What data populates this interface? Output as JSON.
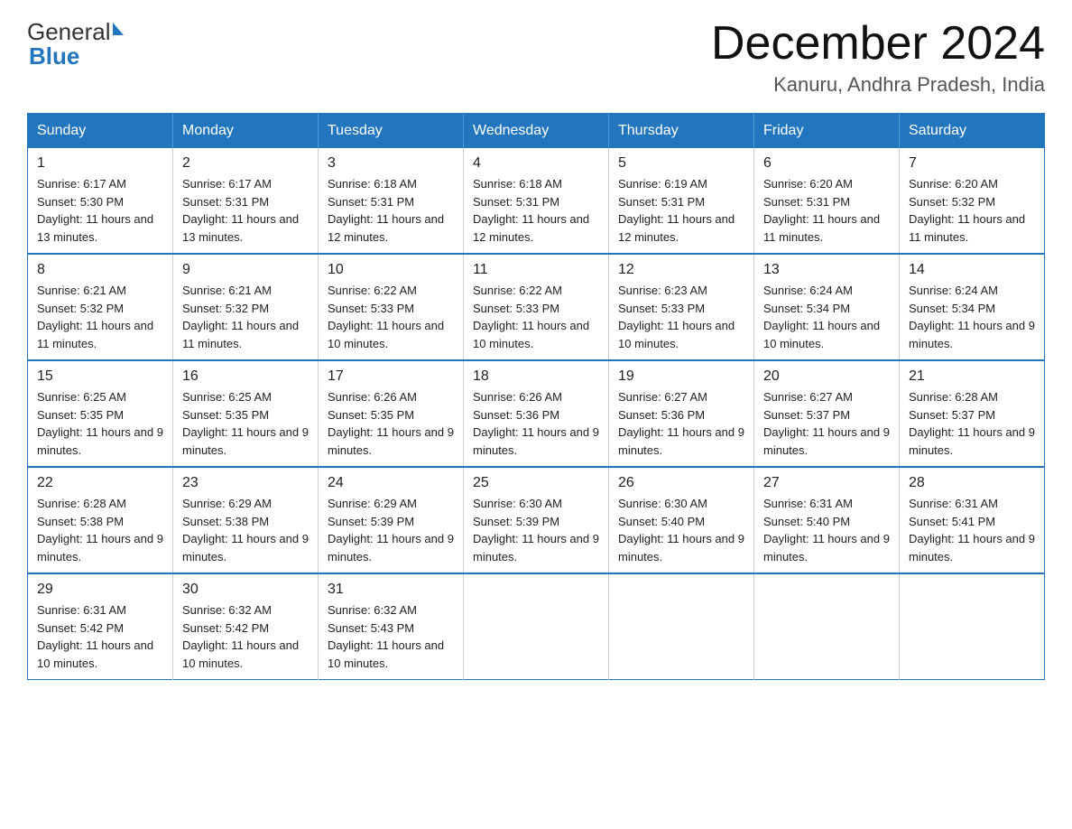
{
  "header": {
    "logo_general": "General",
    "logo_blue": "Blue",
    "month_year": "December 2024",
    "location": "Kanuru, Andhra Pradesh, India"
  },
  "days_of_week": [
    "Sunday",
    "Monday",
    "Tuesday",
    "Wednesday",
    "Thursday",
    "Friday",
    "Saturday"
  ],
  "weeks": [
    [
      {
        "day": "1",
        "sunrise": "6:17 AM",
        "sunset": "5:30 PM",
        "daylight": "11 hours and 13 minutes."
      },
      {
        "day": "2",
        "sunrise": "6:17 AM",
        "sunset": "5:31 PM",
        "daylight": "11 hours and 13 minutes."
      },
      {
        "day": "3",
        "sunrise": "6:18 AM",
        "sunset": "5:31 PM",
        "daylight": "11 hours and 12 minutes."
      },
      {
        "day": "4",
        "sunrise": "6:18 AM",
        "sunset": "5:31 PM",
        "daylight": "11 hours and 12 minutes."
      },
      {
        "day": "5",
        "sunrise": "6:19 AM",
        "sunset": "5:31 PM",
        "daylight": "11 hours and 12 minutes."
      },
      {
        "day": "6",
        "sunrise": "6:20 AM",
        "sunset": "5:31 PM",
        "daylight": "11 hours and 11 minutes."
      },
      {
        "day": "7",
        "sunrise": "6:20 AM",
        "sunset": "5:32 PM",
        "daylight": "11 hours and 11 minutes."
      }
    ],
    [
      {
        "day": "8",
        "sunrise": "6:21 AM",
        "sunset": "5:32 PM",
        "daylight": "11 hours and 11 minutes."
      },
      {
        "day": "9",
        "sunrise": "6:21 AM",
        "sunset": "5:32 PM",
        "daylight": "11 hours and 11 minutes."
      },
      {
        "day": "10",
        "sunrise": "6:22 AM",
        "sunset": "5:33 PM",
        "daylight": "11 hours and 10 minutes."
      },
      {
        "day": "11",
        "sunrise": "6:22 AM",
        "sunset": "5:33 PM",
        "daylight": "11 hours and 10 minutes."
      },
      {
        "day": "12",
        "sunrise": "6:23 AM",
        "sunset": "5:33 PM",
        "daylight": "11 hours and 10 minutes."
      },
      {
        "day": "13",
        "sunrise": "6:24 AM",
        "sunset": "5:34 PM",
        "daylight": "11 hours and 10 minutes."
      },
      {
        "day": "14",
        "sunrise": "6:24 AM",
        "sunset": "5:34 PM",
        "daylight": "11 hours and 9 minutes."
      }
    ],
    [
      {
        "day": "15",
        "sunrise": "6:25 AM",
        "sunset": "5:35 PM",
        "daylight": "11 hours and 9 minutes."
      },
      {
        "day": "16",
        "sunrise": "6:25 AM",
        "sunset": "5:35 PM",
        "daylight": "11 hours and 9 minutes."
      },
      {
        "day": "17",
        "sunrise": "6:26 AM",
        "sunset": "5:35 PM",
        "daylight": "11 hours and 9 minutes."
      },
      {
        "day": "18",
        "sunrise": "6:26 AM",
        "sunset": "5:36 PM",
        "daylight": "11 hours and 9 minutes."
      },
      {
        "day": "19",
        "sunrise": "6:27 AM",
        "sunset": "5:36 PM",
        "daylight": "11 hours and 9 minutes."
      },
      {
        "day": "20",
        "sunrise": "6:27 AM",
        "sunset": "5:37 PM",
        "daylight": "11 hours and 9 minutes."
      },
      {
        "day": "21",
        "sunrise": "6:28 AM",
        "sunset": "5:37 PM",
        "daylight": "11 hours and 9 minutes."
      }
    ],
    [
      {
        "day": "22",
        "sunrise": "6:28 AM",
        "sunset": "5:38 PM",
        "daylight": "11 hours and 9 minutes."
      },
      {
        "day": "23",
        "sunrise": "6:29 AM",
        "sunset": "5:38 PM",
        "daylight": "11 hours and 9 minutes."
      },
      {
        "day": "24",
        "sunrise": "6:29 AM",
        "sunset": "5:39 PM",
        "daylight": "11 hours and 9 minutes."
      },
      {
        "day": "25",
        "sunrise": "6:30 AM",
        "sunset": "5:39 PM",
        "daylight": "11 hours and 9 minutes."
      },
      {
        "day": "26",
        "sunrise": "6:30 AM",
        "sunset": "5:40 PM",
        "daylight": "11 hours and 9 minutes."
      },
      {
        "day": "27",
        "sunrise": "6:31 AM",
        "sunset": "5:40 PM",
        "daylight": "11 hours and 9 minutes."
      },
      {
        "day": "28",
        "sunrise": "6:31 AM",
        "sunset": "5:41 PM",
        "daylight": "11 hours and 9 minutes."
      }
    ],
    [
      {
        "day": "29",
        "sunrise": "6:31 AM",
        "sunset": "5:42 PM",
        "daylight": "11 hours and 10 minutes."
      },
      {
        "day": "30",
        "sunrise": "6:32 AM",
        "sunset": "5:42 PM",
        "daylight": "11 hours and 10 minutes."
      },
      {
        "day": "31",
        "sunrise": "6:32 AM",
        "sunset": "5:43 PM",
        "daylight": "11 hours and 10 minutes."
      },
      null,
      null,
      null,
      null
    ]
  ],
  "labels": {
    "sunrise": "Sunrise:",
    "sunset": "Sunset:",
    "daylight": "Daylight:"
  }
}
